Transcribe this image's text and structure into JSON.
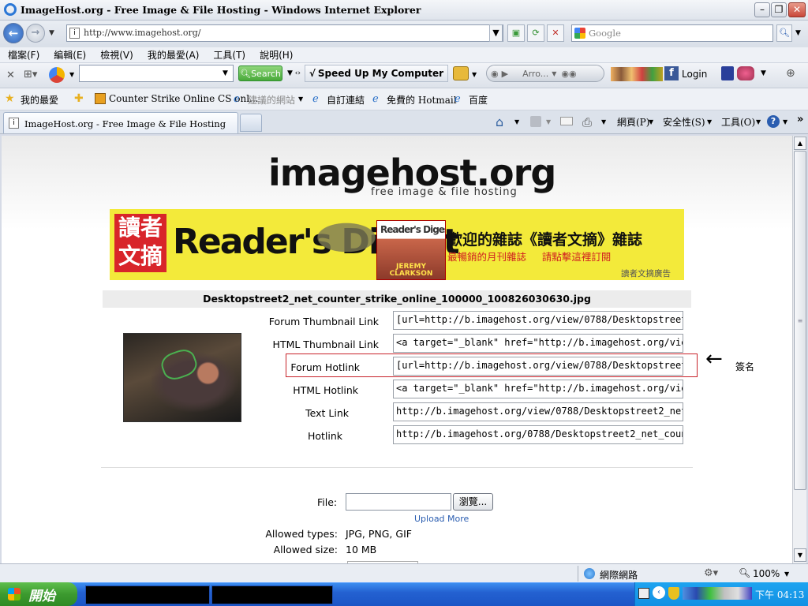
{
  "window": {
    "title": "ImageHost.org - Free Image & File Hosting - Windows Internet Explorer"
  },
  "address": {
    "url": "http://www.imagehost.org/",
    "search_placeholder": "Google"
  },
  "menu": [
    "檔案(F)",
    "編輯(E)",
    "檢視(V)",
    "我的最愛(A)",
    "工具(T)",
    "說明(H)"
  ],
  "toolbar": {
    "search_label": "Search",
    "speedup_label": "Speed Up My Computer",
    "media_label": "Arro...",
    "login_label": "Login"
  },
  "favorites": {
    "title": "我的最愛",
    "items": [
      "Counter Strike Online CS onl...",
      "建議的網站",
      "自訂連結",
      "免費的 Hotmail",
      "百度"
    ]
  },
  "tab": {
    "label": "ImageHost.org - Free Image & File Hosting"
  },
  "commandbar": {
    "page": "網頁(P)",
    "safety": "安全性(S)",
    "tools": "工具(O)"
  },
  "site": {
    "logo": "imagehost.org",
    "tagline": "free image & file hosting",
    "ad": {
      "brand_cn": "讀者文摘",
      "brand_cn_1": "讀者",
      "brand_cn_2": "文摘",
      "brand": "Reader's Digest",
      "text1": "歡迎的雜誌《讀者文摘》雜誌",
      "text2": "最暢銷的月刊雜誌     請點擊這裡訂閱",
      "caption": "讀者文摘廣告",
      "cover_title": "Reader's Digest",
      "cover_name": "JEREMY CLARKSON"
    },
    "filename": "Desktopstreet2_net_counter_strike_online_100000_100826030630.jpg",
    "links": [
      {
        "label": "Forum Thumbnail Link",
        "value": "[url=http://b.imagehost.org/view/0788/Desktopstreet2_net_"
      },
      {
        "label": "HTML Thumbnail Link",
        "value": "<a target=\"_blank\" href=\"http://b.imagehost.org/view/0788/"
      },
      {
        "label": "Forum Hotlink",
        "value": "[url=http://b.imagehost.org/view/0788/Desktopstreet2_net_"
      },
      {
        "label": "HTML Hotlink",
        "value": "<a target=\"_blank\" href=\"http://b.imagehost.org/view/0788/"
      },
      {
        "label": "Text Link",
        "value": "http://b.imagehost.org/view/0788/Desktopstreet2_net_coun"
      },
      {
        "label": "Hotlink",
        "value": "http://b.imagehost.org/0788/Desktopstreet2_net_counter_s"
      }
    ],
    "annotation": "簽名",
    "upload": {
      "file_label": "File:",
      "browse": "瀏覽...",
      "upload_more": "Upload More",
      "types_label": "Allowed types:",
      "types_value": "JPG, PNG, GIF",
      "size_label": "Allowed size:",
      "size_value": "10 MB"
    }
  },
  "status": {
    "zone": "網際網路",
    "zoom": "100%"
  },
  "taskbar": {
    "start": "開始",
    "clock": "下午 04:13"
  }
}
